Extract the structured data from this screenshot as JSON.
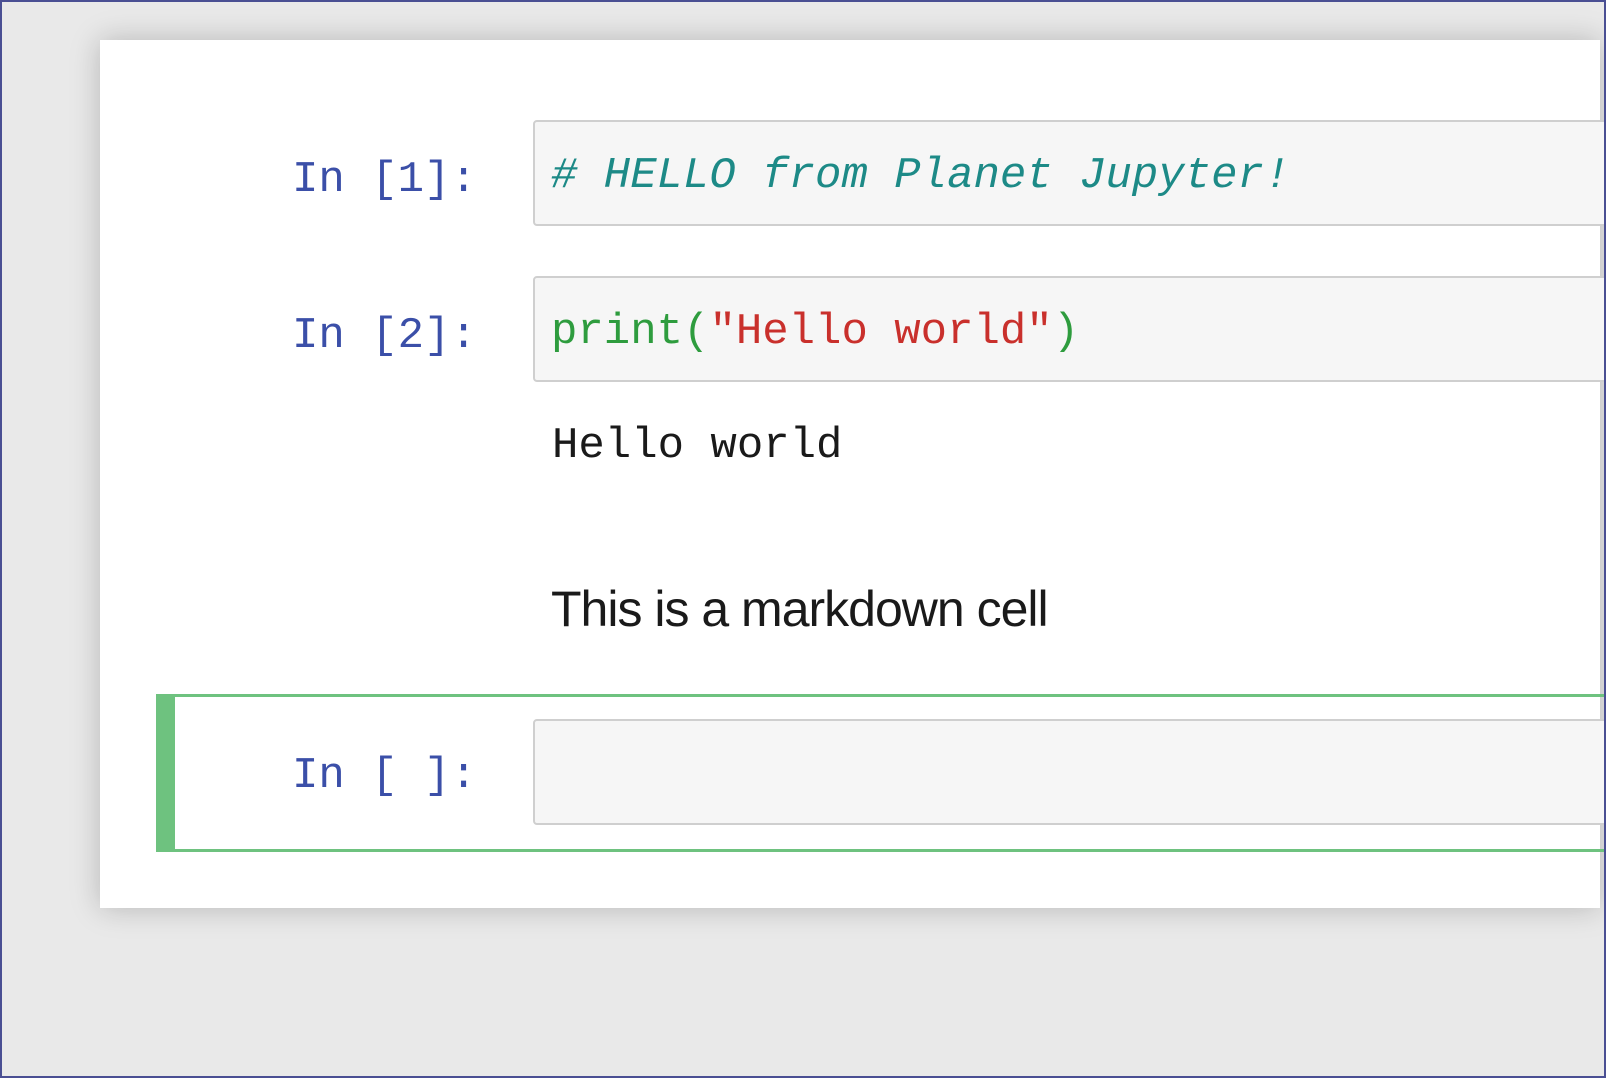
{
  "notebook": {
    "cells": [
      {
        "type": "code",
        "prompt": "In [1]:",
        "comment": "# HELLO from Planet Jupyter!"
      },
      {
        "type": "code",
        "prompt": "In [2]:",
        "code_fn": "print(",
        "code_str": "\"Hello world\"",
        "code_close": ")",
        "output": "Hello world"
      },
      {
        "type": "markdown",
        "text": "This is a markdown cell"
      },
      {
        "type": "code",
        "prompt": "In [ ]:",
        "value": "",
        "selected": true
      }
    ]
  },
  "colors": {
    "prompt": "#3b4fa8",
    "comment": "#1d8a87",
    "builtin": "#2e9c3e",
    "string": "#c9302c",
    "selected_border": "#6ec27f",
    "frame": "#4a4f93"
  }
}
